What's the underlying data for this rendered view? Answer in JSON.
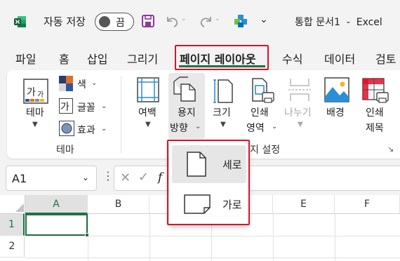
{
  "titlebar": {
    "autosave_label": "자동 저장",
    "autosave_state": "끔",
    "document_title": "통합 문서1  -  Excel",
    "brand_color": "#1e7145"
  },
  "tabs": [
    {
      "label": "파일"
    },
    {
      "label": "홈"
    },
    {
      "label": "삽입"
    },
    {
      "label": "그리기"
    },
    {
      "label": "페이지 레이아웃",
      "active": true
    },
    {
      "label": "수식"
    },
    {
      "label": "데이터"
    },
    {
      "label": "검토"
    }
  ],
  "ribbon": {
    "theme_group": {
      "themes_label": "테마",
      "colors_label": "색",
      "fonts_label": "글꼴",
      "effects_label": "효과",
      "group_label": "테마"
    },
    "page_setup_group": {
      "margins_label": "여백",
      "orientation_line1": "용지",
      "orientation_line2": "방향",
      "size_label": "크기",
      "print_area_line1": "인쇄",
      "print_area_line2": "영역",
      "breaks_label": "나누기",
      "background_label": "배경",
      "print_titles_line1": "인쇄",
      "print_titles_line2": "제목",
      "group_label": "지 설정"
    }
  },
  "orientation_menu": {
    "items": [
      {
        "label": "세로",
        "icon": "portrait-page-icon",
        "selected": true
      },
      {
        "label": "가로",
        "icon": "landscape-page-icon",
        "selected": false
      }
    ]
  },
  "formula_bar": {
    "name_box_value": "A1",
    "fx_label": "f"
  },
  "grid": {
    "columns": [
      "A",
      "B",
      "C",
      "D",
      "E",
      "F"
    ],
    "rows": [
      "1",
      "2"
    ],
    "active_cell": "A1"
  },
  "highlight_color": "#e0102a"
}
